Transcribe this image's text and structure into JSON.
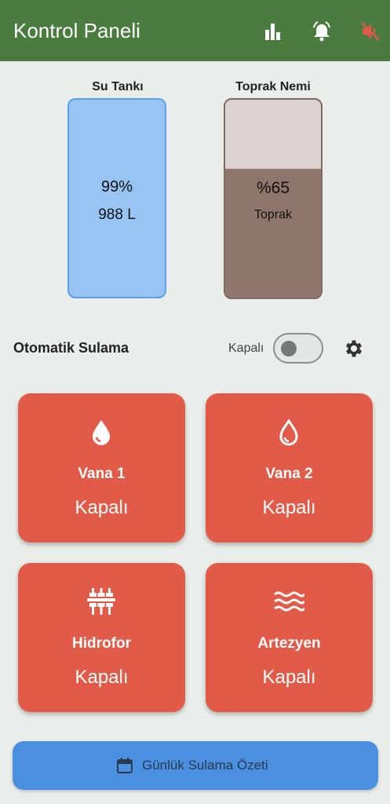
{
  "appbar": {
    "title": "Kontrol Paneli",
    "icons": [
      "bar-chart-icon",
      "bell-alarm-icon",
      "volume-off-icon"
    ],
    "color": "#4a7c3f"
  },
  "water_tank": {
    "label": "Su Tankı",
    "percent_text": "99%",
    "volume_text": "988 L",
    "level": 0.99,
    "color": "#97c4f3"
  },
  "soil_moisture": {
    "label": "Toprak Nemi",
    "percent_text": "%65",
    "sub_text": "Toprak",
    "level": 0.65,
    "color": "#8e766c"
  },
  "auto_irrigation": {
    "label": "Otomatik Sulama",
    "switch_label": "Kapalı",
    "enabled": false
  },
  "devices": [
    {
      "name": "Vana 1",
      "state": "Kapalı",
      "icon": "water-drop-filled-icon"
    },
    {
      "name": "Vana 2",
      "state": "Kapalı",
      "icon": "water-drop-outline-icon"
    },
    {
      "name": "Hidrofor",
      "state": "Kapalı",
      "icon": "pump-icon"
    },
    {
      "name": "Artezyen",
      "state": "Kapalı",
      "icon": "waves-icon"
    }
  ],
  "device_color": "#e25a48",
  "summary_button": {
    "label": "Günlük Sulama Özeti",
    "icon": "calendar-icon"
  }
}
